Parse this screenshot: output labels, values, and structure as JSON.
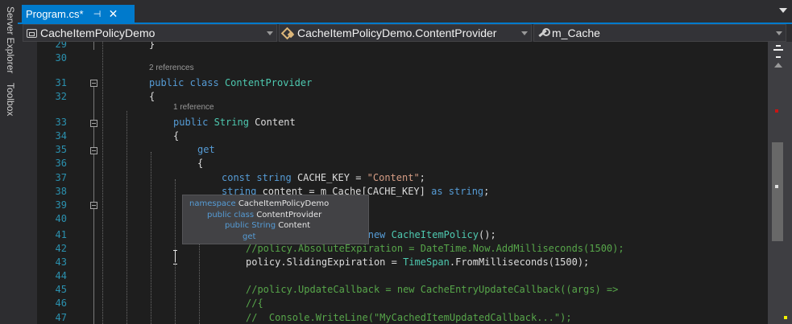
{
  "side_tabs": {
    "server_explorer": "Server Explorer",
    "toolbox": "Toolbox"
  },
  "document_tab": {
    "title": "Program.cs*",
    "pin_glyph": "⊣",
    "close_glyph": "✕"
  },
  "nav_bar": {
    "project": "CacheItemPolicyDemo",
    "class": "CacheItemPolicyDemo.ContentProvider",
    "member": "m_Cache"
  },
  "icons": {
    "project": "csharp-project-icon",
    "class": "class-icon",
    "member": "field-icon"
  },
  "colors": {
    "accent": "#007acc",
    "keyword": "#569cd6",
    "type": "#4ec9b0",
    "string": "#d69d85",
    "comment": "#57a64a",
    "line_number": "#2b91af"
  },
  "code_lines": [
    {
      "num": "29",
      "indent": 4,
      "tokens": [
        {
          "t": "txt",
          "v": "}"
        }
      ]
    },
    {
      "num": "30",
      "indent": 0,
      "tokens": []
    },
    {
      "num": "31",
      "indent": 4,
      "lens": "2 references",
      "tokens": [
        {
          "t": "kw",
          "v": "public"
        },
        {
          "t": "txt",
          "v": " "
        },
        {
          "t": "kw",
          "v": "class"
        },
        {
          "t": "txt",
          "v": " "
        },
        {
          "t": "type",
          "v": "ContentProvider"
        }
      ]
    },
    {
      "num": "32",
      "indent": 4,
      "tokens": [
        {
          "t": "txt",
          "v": "{"
        }
      ]
    },
    {
      "num": "33",
      "indent": 8,
      "lens": "1 reference",
      "tokens": [
        {
          "t": "kw",
          "v": "public"
        },
        {
          "t": "txt",
          "v": " "
        },
        {
          "t": "type",
          "v": "String"
        },
        {
          "t": "txt",
          "v": " Content"
        }
      ]
    },
    {
      "num": "34",
      "indent": 8,
      "tokens": [
        {
          "t": "txt",
          "v": "{"
        }
      ]
    },
    {
      "num": "35",
      "indent": 12,
      "tokens": [
        {
          "t": "kw",
          "v": "get"
        }
      ]
    },
    {
      "num": "36",
      "indent": 12,
      "tokens": [
        {
          "t": "txt",
          "v": "{"
        }
      ]
    },
    {
      "num": "37",
      "indent": 16,
      "tokens": [
        {
          "t": "kw",
          "v": "const"
        },
        {
          "t": "txt",
          "v": " "
        },
        {
          "t": "kw",
          "v": "string"
        },
        {
          "t": "txt",
          "v": " CACHE_KEY = "
        },
        {
          "t": "str",
          "v": "\"Content\""
        },
        {
          "t": "txt",
          "v": ";"
        }
      ]
    },
    {
      "num": "38",
      "indent": 16,
      "tokens": [
        {
          "t": "kw",
          "v": "string"
        },
        {
          "t": "txt",
          "v": " content = m_Cache[CACHE_KEY] "
        },
        {
          "t": "kw",
          "v": "as"
        },
        {
          "t": "txt",
          "v": " "
        },
        {
          "t": "kw",
          "v": "string"
        },
        {
          "t": "txt",
          "v": ";"
        }
      ]
    },
    {
      "num": "39",
      "indent": 16,
      "tokens": []
    },
    {
      "num": "40",
      "indent": 16,
      "tokens": []
    },
    {
      "num": "41",
      "indent": 20,
      "tokens": [
        {
          "t": "txt",
          "v": "                 y = "
        },
        {
          "t": "kw",
          "v": "new"
        },
        {
          "t": "txt",
          "v": " "
        },
        {
          "t": "type",
          "v": "CacheItemPolicy"
        },
        {
          "t": "txt",
          "v": "();"
        }
      ]
    },
    {
      "num": "42",
      "indent": 20,
      "tokens": [
        {
          "t": "cmt",
          "v": "//policy.AbsoluteExpiration = DateTime.Now.AddMilliseconds(1500);"
        }
      ]
    },
    {
      "num": "43",
      "indent": 20,
      "tokens": [
        {
          "t": "txt",
          "v": "policy.SlidingExpiration = "
        },
        {
          "t": "type",
          "v": "TimeSpan"
        },
        {
          "t": "txt",
          "v": ".FromMilliseconds(1500);"
        }
      ]
    },
    {
      "num": "44",
      "indent": 0,
      "tokens": []
    },
    {
      "num": "45",
      "indent": 20,
      "tokens": [
        {
          "t": "cmt",
          "v": "//policy.UpdateCallback = new CacheEntryUpdateCallback((args) =>"
        }
      ]
    },
    {
      "num": "46",
      "indent": 20,
      "tokens": [
        {
          "t": "cmt",
          "v": "//{"
        }
      ]
    },
    {
      "num": "47",
      "indent": 20,
      "tokens": [
        {
          "t": "cmt",
          "v": "//  Console.WriteLine(\"MyCachedItemUpdatedCallback...\");"
        }
      ]
    }
  ],
  "tooltip": {
    "lines": [
      {
        "kw": "namespace",
        "name": "CacheItemPolicyDemo"
      },
      {
        "kw": "public class",
        "name": "ContentProvider"
      },
      {
        "kw": "public String",
        "name": "Content"
      },
      {
        "kw": "get",
        "name": ""
      }
    ]
  },
  "scrollbar": {
    "position_fraction": 0.47,
    "visible_fraction": 0.4
  }
}
